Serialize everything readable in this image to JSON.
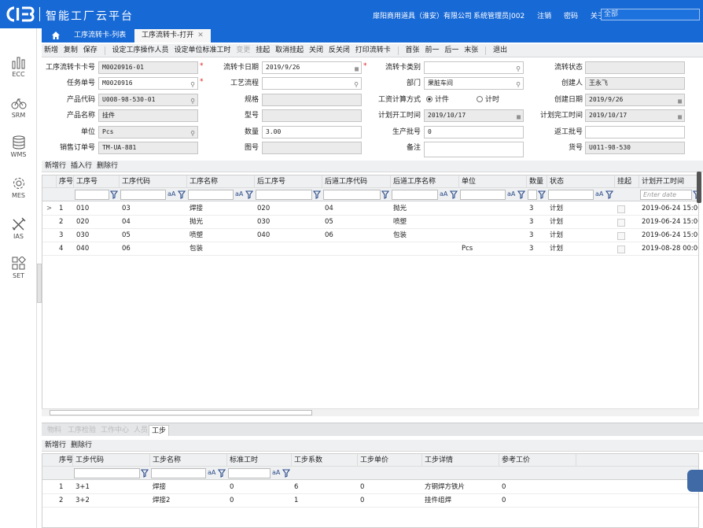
{
  "app": {
    "title": "智能工厂云平台",
    "company": "扉阳商用道具（淮安）有限公司",
    "user": "系统管理员|002",
    "logout": "注销",
    "password": "密码",
    "about": "关于",
    "search_placeholder": "全部",
    "brand_color": "#1769d6"
  },
  "tabs": [
    {
      "label": "工序流转卡-列表"
    },
    {
      "label": "工序流转卡-打开"
    }
  ],
  "sidebar": [
    {
      "label": "ECC"
    },
    {
      "label": "SRM"
    },
    {
      "label": "WMS"
    },
    {
      "label": "MES"
    },
    {
      "label": "IAS"
    },
    {
      "label": "SET"
    }
  ],
  "toolbar": {
    "items": [
      "新增",
      "复制",
      "保存",
      "设定工序操作人员",
      "设定单位标准工时",
      "变更",
      "挂起",
      "取消挂起",
      "关闭",
      "反关闭",
      "打印流转卡"
    ],
    "nav": [
      "首张",
      "前一",
      "后一",
      "末张",
      "退出"
    ]
  },
  "form": {
    "card_no_label": "工序流转卡卡号",
    "card_no": "M0020916-01",
    "card_date_label": "流转卡日期",
    "card_date": "2019/9/26",
    "card_type_label": "流转卡类别",
    "card_type": "",
    "status_label": "流转状态",
    "status": "",
    "task_no_label": "任务单号",
    "task_no": "M0020916",
    "process_label": "工艺流程",
    "process": "",
    "dept_label": "部门",
    "dept": "果脏车间",
    "creator_label": "创建人",
    "creator": "王永飞",
    "product_code_label": "产品代码",
    "product_code": "U008-98-530-01",
    "spec_label": "规格",
    "spec": "",
    "calc_label": "工资计算方式",
    "calc_piece": "计件",
    "calc_time": "计时",
    "created_label": "创建日期",
    "created": "2019/9/26",
    "product_name_label": "产品名称",
    "product_name": "挂件",
    "model_label": "型号",
    "model": "",
    "plan_start_label": "计划开工时间",
    "plan_start": "2019/10/17",
    "plan_end_label": "计划完工时间",
    "plan_end": "2019/10/17",
    "unit_label": "单位",
    "unit": "Pcs",
    "qty_label": "数量",
    "qty": "3.00",
    "batch_label": "生产批号",
    "batch": "0",
    "rework_label": "返工批号",
    "rework": "",
    "sales_label": "销售订单号",
    "sales": "TM-UA-881",
    "drawing_label": "图号",
    "drawing": "",
    "remark_label": "备注",
    "remark": "",
    "item_no_label": "货号",
    "item_no": "U011-98-530"
  },
  "grid1": {
    "actions": [
      "新增行",
      "插入行",
      "删除行"
    ],
    "columns": [
      "序号",
      "工序号",
      "工序代码",
      "工序名称",
      "后工序号",
      "后道工序代码",
      "后道工序名称",
      "单位",
      "数量",
      "状态",
      "挂起",
      "计划开工时间"
    ],
    "date_placeholder": "Enter date",
    "rows": [
      [
        "1",
        "010",
        "03",
        "焊接",
        "020",
        "04",
        "抛光",
        "",
        "3",
        "计划",
        "",
        "2019-06-24 15:00"
      ],
      [
        "2",
        "020",
        "04",
        "抛光",
        "030",
        "05",
        "喷塑",
        "",
        "3",
        "计划",
        "",
        "2019-06-24 15:00"
      ],
      [
        "3",
        "030",
        "05",
        "喷塑",
        "040",
        "06",
        "包装",
        "",
        "3",
        "计划",
        "",
        "2019-06-24 15:00"
      ],
      [
        "4",
        "040",
        "06",
        "包装",
        "",
        "",
        "",
        "Pcs",
        "3",
        "计划",
        "",
        "2019-08-28 00:00"
      ]
    ]
  },
  "lower_tabs": [
    "物料",
    "工序检验",
    "工作中心",
    "人员",
    "工步"
  ],
  "grid2": {
    "actions": [
      "新增行",
      "删除行"
    ],
    "columns": [
      "序号",
      "工步代码",
      "工步名称",
      "标准工时",
      "工步系数",
      "工步单价",
      "工步详情",
      "参考工价"
    ],
    "rows": [
      [
        "1",
        "3+1",
        "焊接",
        "0",
        "6",
        "0",
        "方钢焊方铁片",
        "0"
      ],
      [
        "2",
        "3+2",
        "焊接2",
        "0",
        "1",
        "0",
        "挂件组焊",
        "0"
      ]
    ]
  }
}
